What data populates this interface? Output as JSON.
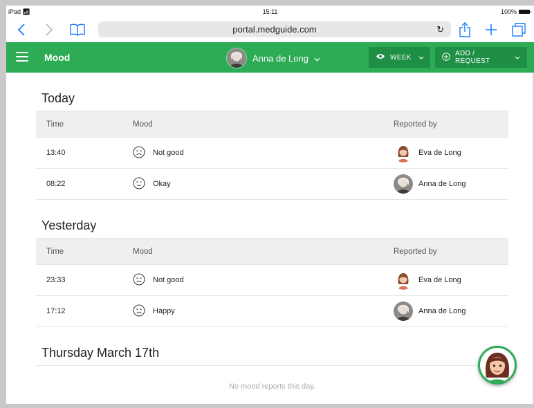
{
  "status_bar": {
    "carrier": "iPad",
    "time": "15:11",
    "battery": "100%"
  },
  "browser": {
    "url": "portal.medguide.com"
  },
  "colors": {
    "brand": "#2dab55",
    "brand_dark": "#1e8f44",
    "link": "#1a7bff"
  },
  "header": {
    "title": "Mood",
    "user": "Anna de Long",
    "view_button": "WEEK",
    "add_button": "ADD / REQUEST"
  },
  "columns": {
    "time": "Time",
    "mood": "Mood",
    "reported_by": "Reported by"
  },
  "sections": [
    {
      "title": "Today",
      "rows": [
        {
          "time": "13:40",
          "mood": "Not good",
          "mood_icon": "sad-face-icon",
          "reporter": "Eva de Long"
        },
        {
          "time": "08:22",
          "mood": "Okay",
          "mood_icon": "neutral-face-icon",
          "reporter": "Anna de Long"
        }
      ]
    },
    {
      "title": "Yesterday",
      "rows": [
        {
          "time": "23:33",
          "mood": "Not good",
          "mood_icon": "sad-face-icon",
          "reporter": "Eva de Long"
        },
        {
          "time": "17:12",
          "mood": "Happy",
          "mood_icon": "happy-face-icon",
          "reporter": "Anna de Long"
        }
      ]
    },
    {
      "title": "Thursday March 17th",
      "empty_text": "No mood reports this day."
    }
  ]
}
